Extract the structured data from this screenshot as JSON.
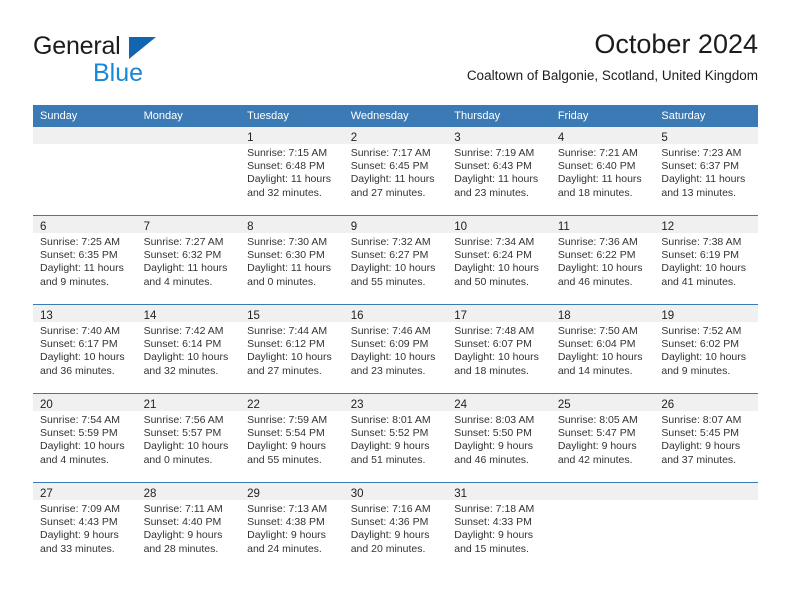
{
  "brand": {
    "name_top": "General",
    "name_bottom": "Blue",
    "triangle_icon": "blue-triangle-logo-icon",
    "color_dark": "#1c1c1c",
    "color_blue": "#1787d8"
  },
  "header": {
    "title": "October 2024",
    "subtitle": "Coaltown of Balgonie, Scotland, United Kingdom"
  },
  "theme": {
    "header_blue": "#3b7ab5",
    "daynum_band": "#f0f0f0",
    "text": "#333333"
  },
  "weekday_headers": [
    "Sunday",
    "Monday",
    "Tuesday",
    "Wednesday",
    "Thursday",
    "Friday",
    "Saturday"
  ],
  "weeks": [
    [
      {
        "day": "",
        "lines": []
      },
      {
        "day": "",
        "lines": []
      },
      {
        "day": "1",
        "lines": [
          "Sunrise: 7:15 AM",
          "Sunset: 6:48 PM",
          "Daylight: 11 hours",
          "and 32 minutes."
        ]
      },
      {
        "day": "2",
        "lines": [
          "Sunrise: 7:17 AM",
          "Sunset: 6:45 PM",
          "Daylight: 11 hours",
          "and 27 minutes."
        ]
      },
      {
        "day": "3",
        "lines": [
          "Sunrise: 7:19 AM",
          "Sunset: 6:43 PM",
          "Daylight: 11 hours",
          "and 23 minutes."
        ]
      },
      {
        "day": "4",
        "lines": [
          "Sunrise: 7:21 AM",
          "Sunset: 6:40 PM",
          "Daylight: 11 hours",
          "and 18 minutes."
        ]
      },
      {
        "day": "5",
        "lines": [
          "Sunrise: 7:23 AM",
          "Sunset: 6:37 PM",
          "Daylight: 11 hours",
          "and 13 minutes."
        ]
      }
    ],
    [
      {
        "day": "6",
        "lines": [
          "Sunrise: 7:25 AM",
          "Sunset: 6:35 PM",
          "Daylight: 11 hours",
          "and 9 minutes."
        ]
      },
      {
        "day": "7",
        "lines": [
          "Sunrise: 7:27 AM",
          "Sunset: 6:32 PM",
          "Daylight: 11 hours",
          "and 4 minutes."
        ]
      },
      {
        "day": "8",
        "lines": [
          "Sunrise: 7:30 AM",
          "Sunset: 6:30 PM",
          "Daylight: 11 hours",
          "and 0 minutes."
        ]
      },
      {
        "day": "9",
        "lines": [
          "Sunrise: 7:32 AM",
          "Sunset: 6:27 PM",
          "Daylight: 10 hours",
          "and 55 minutes."
        ]
      },
      {
        "day": "10",
        "lines": [
          "Sunrise: 7:34 AM",
          "Sunset: 6:24 PM",
          "Daylight: 10 hours",
          "and 50 minutes."
        ]
      },
      {
        "day": "11",
        "lines": [
          "Sunrise: 7:36 AM",
          "Sunset: 6:22 PM",
          "Daylight: 10 hours",
          "and 46 minutes."
        ]
      },
      {
        "day": "12",
        "lines": [
          "Sunrise: 7:38 AM",
          "Sunset: 6:19 PM",
          "Daylight: 10 hours",
          "and 41 minutes."
        ]
      }
    ],
    [
      {
        "day": "13",
        "lines": [
          "Sunrise: 7:40 AM",
          "Sunset: 6:17 PM",
          "Daylight: 10 hours",
          "and 36 minutes."
        ]
      },
      {
        "day": "14",
        "lines": [
          "Sunrise: 7:42 AM",
          "Sunset: 6:14 PM",
          "Daylight: 10 hours",
          "and 32 minutes."
        ]
      },
      {
        "day": "15",
        "lines": [
          "Sunrise: 7:44 AM",
          "Sunset: 6:12 PM",
          "Daylight: 10 hours",
          "and 27 minutes."
        ]
      },
      {
        "day": "16",
        "lines": [
          "Sunrise: 7:46 AM",
          "Sunset: 6:09 PM",
          "Daylight: 10 hours",
          "and 23 minutes."
        ]
      },
      {
        "day": "17",
        "lines": [
          "Sunrise: 7:48 AM",
          "Sunset: 6:07 PM",
          "Daylight: 10 hours",
          "and 18 minutes."
        ]
      },
      {
        "day": "18",
        "lines": [
          "Sunrise: 7:50 AM",
          "Sunset: 6:04 PM",
          "Daylight: 10 hours",
          "and 14 minutes."
        ]
      },
      {
        "day": "19",
        "lines": [
          "Sunrise: 7:52 AM",
          "Sunset: 6:02 PM",
          "Daylight: 10 hours",
          "and 9 minutes."
        ]
      }
    ],
    [
      {
        "day": "20",
        "lines": [
          "Sunrise: 7:54 AM",
          "Sunset: 5:59 PM",
          "Daylight: 10 hours",
          "and 4 minutes."
        ]
      },
      {
        "day": "21",
        "lines": [
          "Sunrise: 7:56 AM",
          "Sunset: 5:57 PM",
          "Daylight: 10 hours",
          "and 0 minutes."
        ]
      },
      {
        "day": "22",
        "lines": [
          "Sunrise: 7:59 AM",
          "Sunset: 5:54 PM",
          "Daylight: 9 hours",
          "and 55 minutes."
        ]
      },
      {
        "day": "23",
        "lines": [
          "Sunrise: 8:01 AM",
          "Sunset: 5:52 PM",
          "Daylight: 9 hours",
          "and 51 minutes."
        ]
      },
      {
        "day": "24",
        "lines": [
          "Sunrise: 8:03 AM",
          "Sunset: 5:50 PM",
          "Daylight: 9 hours",
          "and 46 minutes."
        ]
      },
      {
        "day": "25",
        "lines": [
          "Sunrise: 8:05 AM",
          "Sunset: 5:47 PM",
          "Daylight: 9 hours",
          "and 42 minutes."
        ]
      },
      {
        "day": "26",
        "lines": [
          "Sunrise: 8:07 AM",
          "Sunset: 5:45 PM",
          "Daylight: 9 hours",
          "and 37 minutes."
        ]
      }
    ],
    [
      {
        "day": "27",
        "lines": [
          "Sunrise: 7:09 AM",
          "Sunset: 4:43 PM",
          "Daylight: 9 hours",
          "and 33 minutes."
        ]
      },
      {
        "day": "28",
        "lines": [
          "Sunrise: 7:11 AM",
          "Sunset: 4:40 PM",
          "Daylight: 9 hours",
          "and 28 minutes."
        ]
      },
      {
        "day": "29",
        "lines": [
          "Sunrise: 7:13 AM",
          "Sunset: 4:38 PM",
          "Daylight: 9 hours",
          "and 24 minutes."
        ]
      },
      {
        "day": "30",
        "lines": [
          "Sunrise: 7:16 AM",
          "Sunset: 4:36 PM",
          "Daylight: 9 hours",
          "and 20 minutes."
        ]
      },
      {
        "day": "31",
        "lines": [
          "Sunrise: 7:18 AM",
          "Sunset: 4:33 PM",
          "Daylight: 9 hours",
          "and 15 minutes."
        ]
      },
      {
        "day": "",
        "lines": []
      },
      {
        "day": "",
        "lines": []
      }
    ]
  ]
}
